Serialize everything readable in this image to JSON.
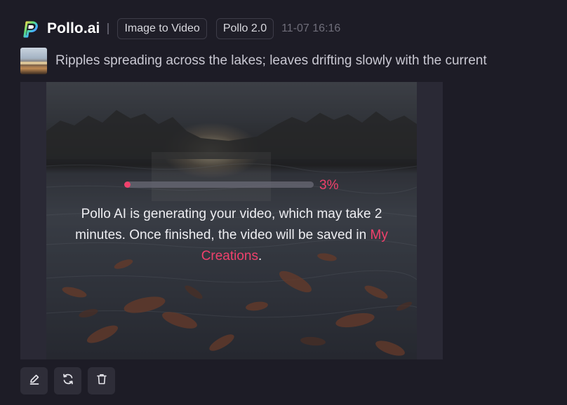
{
  "header": {
    "logo_icon": "pollo-logo-icon",
    "brand": "Pollo.ai",
    "tags": [
      "Image to Video",
      "Pollo 2.0"
    ],
    "timestamp": "11-07 16:16"
  },
  "prompt": {
    "thumbnail_icon": "lake-thumbnail",
    "text": "Ripples spreading across the lakes; leaves drifting slowly with the current"
  },
  "generation": {
    "progress": 0.03,
    "progress_label": "3%",
    "message_before_link": "Pollo AI is generating your video, which may take 2 minutes. Once finished, the video will be saved in ",
    "link_text": "My Creations",
    "message_after_link": "."
  },
  "actions": [
    {
      "name": "edit-button",
      "icon": "pencil-icon"
    },
    {
      "name": "regenerate-button",
      "icon": "refresh-icon"
    },
    {
      "name": "delete-button",
      "icon": "trash-icon"
    }
  ],
  "colors": {
    "accent": "#f0416c",
    "background": "#1d1c26",
    "panel": "#2a2935"
  }
}
